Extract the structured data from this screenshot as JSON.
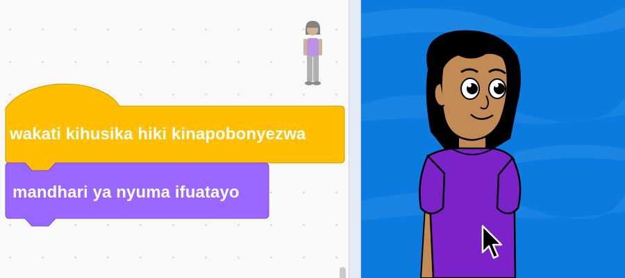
{
  "workspace": {
    "hat_block": {
      "label": "wakati kihusika hiki kinapobonyezwa",
      "color": "#ffbf00",
      "border": "#cc9900"
    },
    "looks_block": {
      "label": "mandhari ya nyuma ifuatayo",
      "color": "#9966ff",
      "border": "#774dcb"
    },
    "sprite_thumbnail": "avatar-icon"
  },
  "stage": {
    "backdrop_color": "#0b7be0",
    "sprite": "girl-character",
    "cursor": "mouse-pointer-icon"
  }
}
